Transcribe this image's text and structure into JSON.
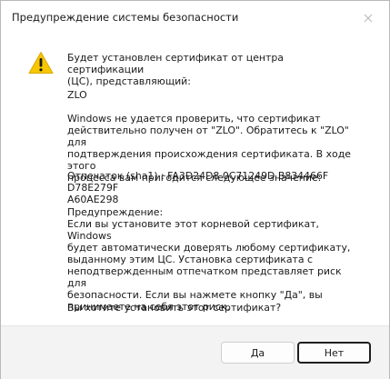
{
  "window": {
    "title": "Предупреждение системы безопасности"
  },
  "icons": {
    "warning": "warning-icon",
    "close": "close-icon"
  },
  "colors": {
    "warning_fill": "#f7c600",
    "footer_bg": "#f3f3f3"
  },
  "message": {
    "intro_line1": "Будет установлен сертификат от центра сертификации",
    "intro_line2": "(ЦС), представляющий:",
    "issuer": "ZLO",
    "verify_line1": "Windows не удается проверить, что сертификат",
    "verify_line2": "действительно получен от \"ZLO\". Обратитесь к \"ZLO\" для",
    "verify_line3": "подтверждения происхождения сертификата. В ходе этого",
    "verify_line4": "процесса вам пригодится следующее значение:",
    "thumbprint_line1": "Отпечаток (sha1) : FA3D24D8 0C71249D B834466F D78E279F",
    "thumbprint_line2": "A60AE298",
    "warning_heading": "Предупреждение:",
    "warning_line1": "Если вы установите этот корневой сертификат, Windows",
    "warning_line2": "будет автоматически доверять любому сертификату,",
    "warning_line3": "выданному этим ЦС. Установка сертификата с",
    "warning_line4": "неподтвержденным отпечатком представляет риск для",
    "warning_line5": "безопасности. Если вы нажмете кнопку \"Да\", вы",
    "warning_line6": "принимаете на себя этот риск.",
    "question": "Вы хотите установить этот сертификат?"
  },
  "buttons": {
    "yes": "Да",
    "no": "Нет"
  }
}
